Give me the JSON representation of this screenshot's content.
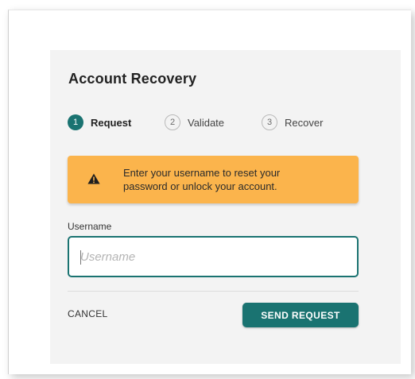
{
  "colors": {
    "accent": "#1a7371",
    "warning": "#fbb44c",
    "card_bg": "#f3f3f3"
  },
  "header": {
    "title": "Account Recovery"
  },
  "stepper": {
    "steps": [
      {
        "number": "1",
        "label": "Request",
        "state": "active"
      },
      {
        "number": "2",
        "label": "Validate",
        "state": "inactive"
      },
      {
        "number": "3",
        "label": "Recover",
        "state": "inactive"
      }
    ]
  },
  "alert": {
    "icon": "warning-icon",
    "line1": "Enter your username to reset your",
    "line2": "password or unlock your account."
  },
  "form": {
    "username_label": "Username",
    "username_value": "",
    "username_placeholder": "Username"
  },
  "actions": {
    "cancel_label": "CANCEL",
    "send_label": "SEND REQUEST"
  }
}
